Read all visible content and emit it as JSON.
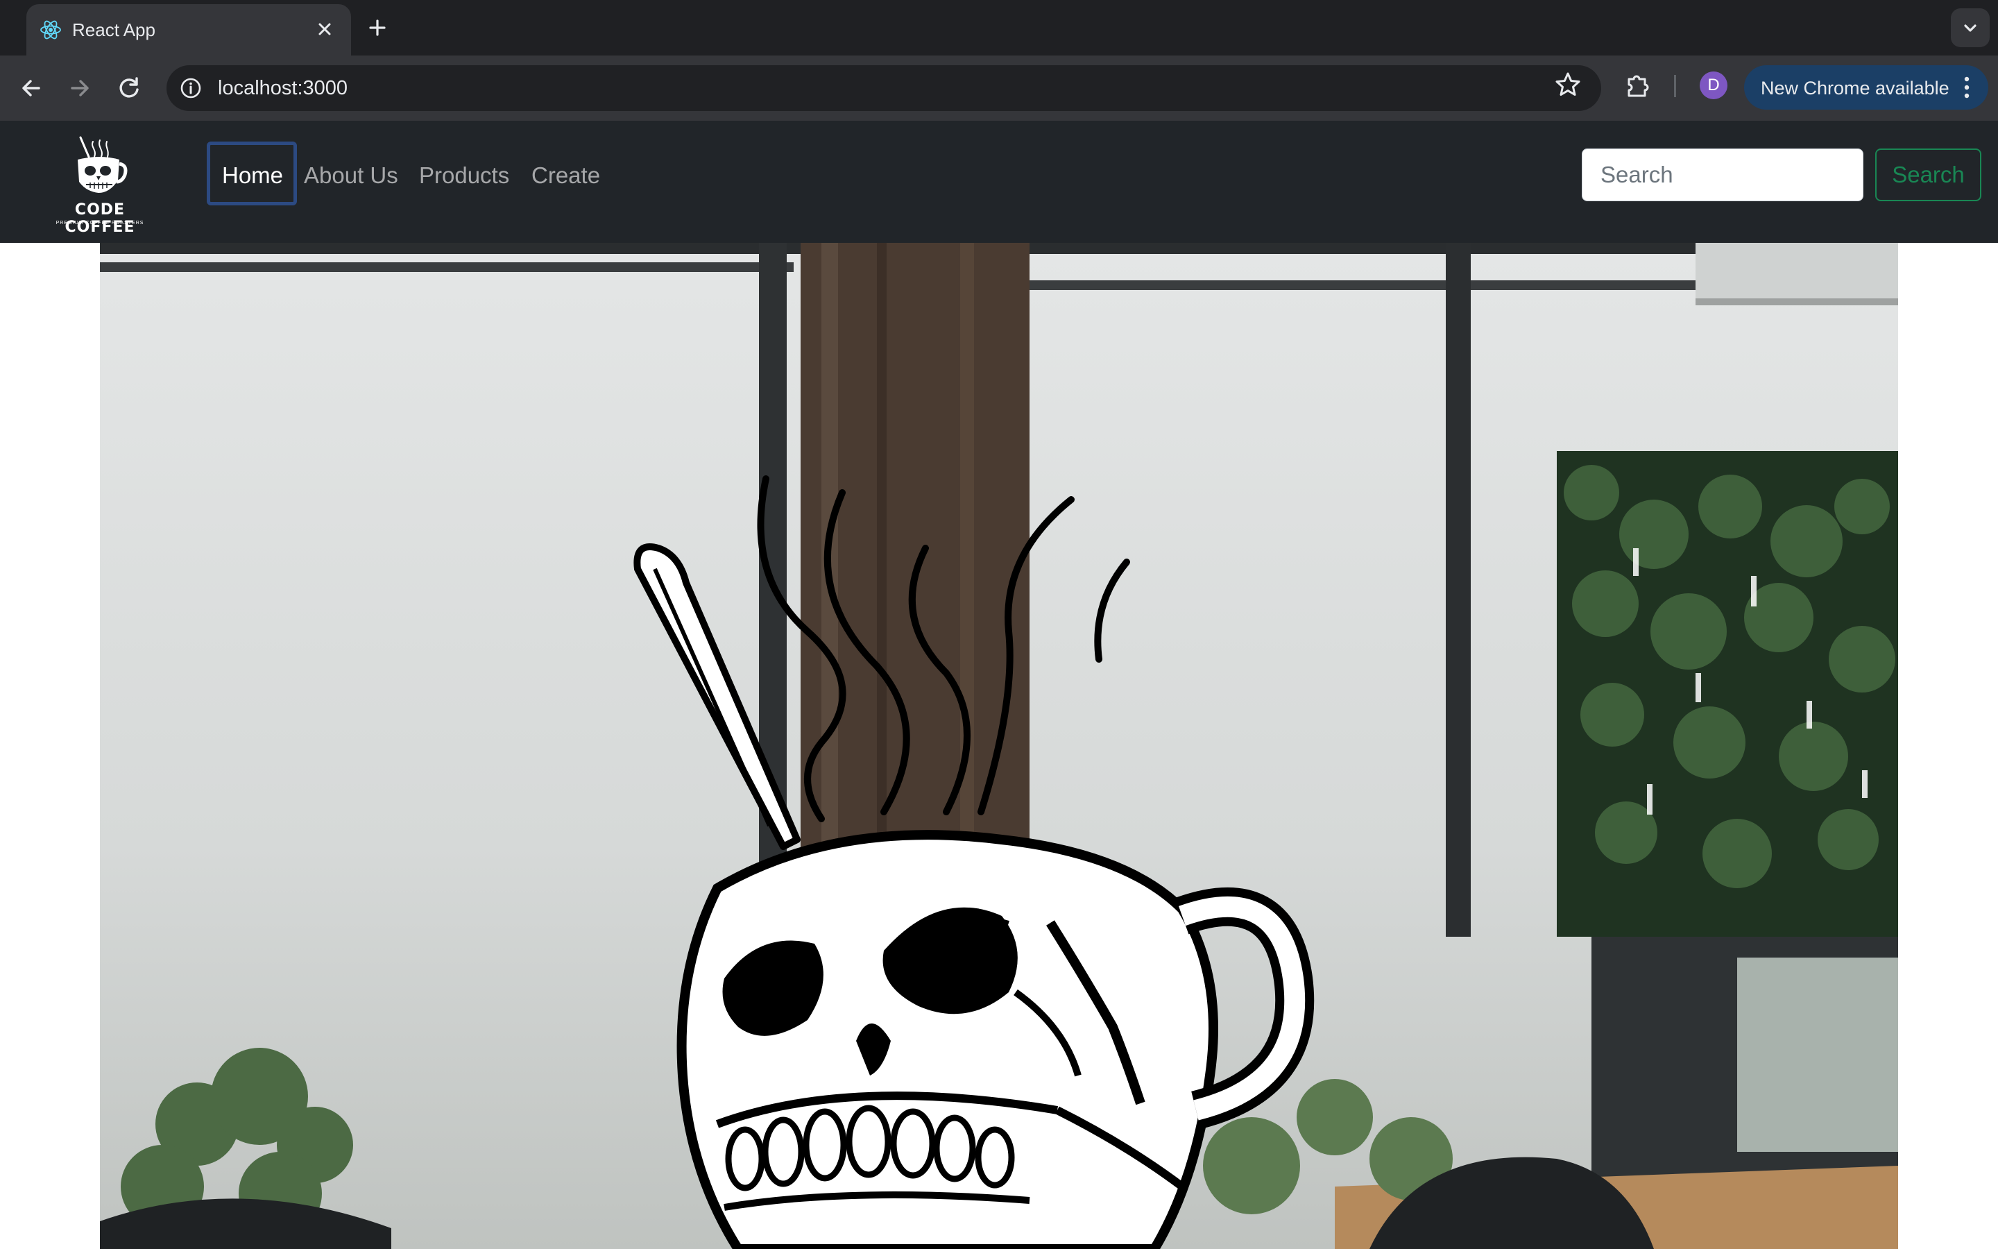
{
  "browser": {
    "tab": {
      "title": "React App",
      "favicon": "react-logo-icon",
      "close_icon": "close-icon"
    },
    "new_tab_icon": "plus-icon",
    "tab_list_icon": "chevron-down-icon",
    "toolbar": {
      "back_icon": "arrow-left-icon",
      "forward_icon": "arrow-right-icon",
      "reload_icon": "reload-icon",
      "site_info_icon": "info-icon",
      "url": "localhost:3000",
      "bookmark_icon": "star-icon",
      "extensions_icon": "puzzle-icon",
      "profile_initial": "D",
      "update_label": "New Chrome available",
      "update_menu_icon": "kebab-menu-icon"
    }
  },
  "navbar": {
    "brand": {
      "name": "CODE COFFEE",
      "tagline": "PREMIUM COFFEE ROASTERS"
    },
    "links": [
      {
        "label": "Home",
        "active": true
      },
      {
        "label": "About Us",
        "active": false
      },
      {
        "label": "Products",
        "active": false
      },
      {
        "label": "Create",
        "active": false
      }
    ],
    "search": {
      "placeholder": "Search",
      "button_label": "Search"
    }
  },
  "hero": {
    "image": "skull-coffee-mug-over-cafe-interior-photo"
  },
  "colors": {
    "navbar_bg": "#212529",
    "search_accent": "#198754",
    "focus_outline": "#2c4a82",
    "tab_bg": "#35363a",
    "update_pill": "#1b3f66"
  }
}
